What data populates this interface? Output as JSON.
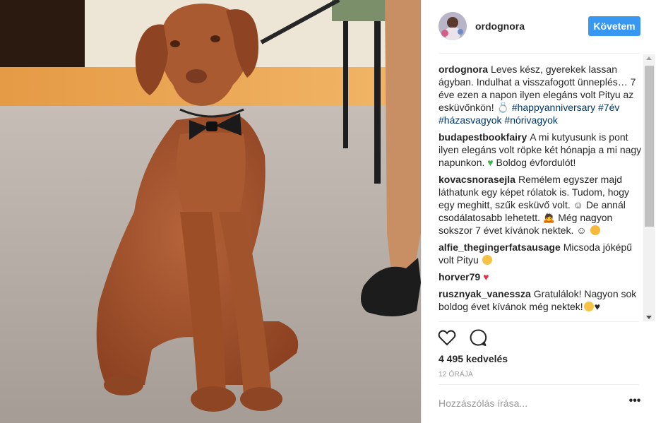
{
  "post": {
    "username": "ordognora",
    "follow_label": "Követem",
    "likes_text": "4 495 kedvelés",
    "time_text": "12 ÓRÁJA",
    "add_comment_placeholder": "Hozzászólás írása...",
    "more_label": "•••"
  },
  "caption": {
    "author": "ordognora",
    "text": "Leves kész, gyerekek lassan ágyban. Indulhat a visszafogott ünneplés… 7 éve ezen a napon ilyen elegáns volt Pityu az esküvőnkön! ",
    "hashtags": [
      "#happyanniversary",
      "#7év",
      "#házasvagyok",
      "#nórivagyok"
    ]
  },
  "comments": [
    {
      "author": "budapestbookfairy",
      "text": "A mi kutyusunk is pont ilyen elegáns volt röpke két hónapja a mi nagy napunkon. ",
      "text_after": " Boldog évfordulót!",
      "emoji": "green-heart"
    },
    {
      "author": "kovacsnorasejla",
      "text": "Remélem egyszer majd láthatunk egy képet rólatok is. Tudom, hogy egy meghitt, szűk esküvő volt. ☺ De annál csodálatosabb lehetett. ",
      "text_after": " Még nagyon sokszor 7 évet kívánok nektek. ☺",
      "emoji": "person-bowing"
    },
    {
      "author": "alfie_thegingerfatsausage",
      "text": "Micsoda jóképű volt Pityu ",
      "emoji": "hugging-face"
    },
    {
      "author": "horver79",
      "text": "",
      "emoji": "red-heart"
    },
    {
      "author": "rusznyak_vanessza",
      "text": "Gratulálok! Nagyon sok boldog évet kívánok még nektek!",
      "emoji": "smiling-face"
    }
  ],
  "icons": {
    "like": "heart-outline-icon",
    "comment": "speech-bubble-icon",
    "more": "more-dots-icon"
  },
  "colors": {
    "follow_button": "#3897f0",
    "hashtag": "#003569",
    "muted": "#999999",
    "dog": "#a0522d"
  }
}
